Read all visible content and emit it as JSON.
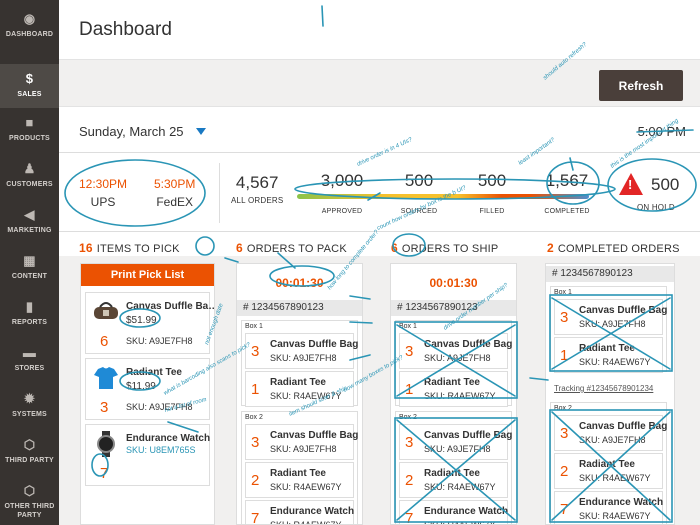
{
  "nav": [
    {
      "label": "DASHBOARD",
      "icon": "dashboard-icon",
      "glyph": "◉"
    },
    {
      "label": "SALES",
      "icon": "dollar-icon",
      "glyph": "$"
    },
    {
      "label": "PRODUCTS",
      "icon": "box-icon",
      "glyph": "■"
    },
    {
      "label": "CUSTOMERS",
      "icon": "person-icon",
      "glyph": "♟"
    },
    {
      "label": "MARKETING",
      "icon": "megaphone-icon",
      "glyph": "◀"
    },
    {
      "label": "CONTENT",
      "icon": "content-icon",
      "glyph": "▦"
    },
    {
      "label": "REPORTS",
      "icon": "bar-chart-icon",
      "glyph": "▮"
    },
    {
      "label": "STORES",
      "icon": "store-icon",
      "glyph": "▬"
    },
    {
      "label": "SYSTEMS",
      "icon": "gear-icon",
      "glyph": "✹"
    },
    {
      "label": "THIRD PARTY",
      "icon": "hexagon-icon",
      "glyph": "⬡"
    },
    {
      "label": "OTHER THIRD PARTY",
      "icon": "hexagon-icon",
      "glyph": "⬡"
    }
  ],
  "header": {
    "title": "Dashboard"
  },
  "toolbar": {
    "refresh_label": "Refresh"
  },
  "date": {
    "label": "Sunday, March 25",
    "time": "5:00 PM"
  },
  "carriers": [
    {
      "time": "12:30PM",
      "name": "UPS"
    },
    {
      "time": "5:30PM",
      "name": "FedEX"
    }
  ],
  "metrics": {
    "all_orders": {
      "value": "4,567",
      "label": "ALL ORDERS"
    },
    "stats": [
      {
        "value": "3,000",
        "label": "APPROVED"
      },
      {
        "value": "500",
        "label": "SOURCED"
      },
      {
        "value": "500",
        "label": "FILLED"
      },
      {
        "value": "1,567",
        "label": "COMPLETED"
      }
    ],
    "on_hold": {
      "value": "500",
      "label": "ON HOLD",
      "icon_glyph": "!"
    }
  },
  "columns": {
    "pick": {
      "count": "16",
      "label": "ITEMS TO PICK",
      "button": "Print Pick List"
    },
    "pack": {
      "count": "6",
      "label": "ORDERS TO PACK",
      "timer": "00:01:30",
      "order": "# 1234567890123"
    },
    "ship": {
      "count": "6",
      "label": "ORDERS TO SHIP",
      "timer": "00:01:30",
      "order": "# 1234567890123"
    },
    "completed": {
      "count": "2",
      "label": "COMPLETED ORDERS",
      "order": "# 1234567890123",
      "tracking": "Tracking #12345678901234"
    }
  },
  "pick_items": [
    {
      "name": "Canvas Duffle Ba…",
      "price": "$51.99",
      "qty": "6",
      "sku": "SKU: A9JE7FH8"
    },
    {
      "name": "Radiant Tee",
      "price": "$11.99",
      "qty": "3",
      "sku": "SKU: A9JE7FH8"
    },
    {
      "name": "Endurance Watch",
      "price": "",
      "qty": "7",
      "sku": "SKU: U8EM765S"
    }
  ],
  "box_labels": {
    "box1": "Box 1",
    "box2": "Box 2"
  },
  "lines": {
    "duffle": {
      "qty": "3",
      "name": "Canvas Duffle Bag",
      "sku": "SKU: A9JE7FH8"
    },
    "tee": {
      "qty": "1",
      "name": "Radiant Tee",
      "sku": "SKU: R4AEW67Y"
    },
    "tee2": {
      "qty": "2",
      "name": "Radiant Tee",
      "sku": "SKU: R4AEW67Y"
    },
    "watch": {
      "qty": "7",
      "name": "Endurance Watch",
      "sku": "SKU: R4AEW67Y"
    }
  },
  "annotations": [
    "should auto refresh?",
    "drive order is in 4 UIs?",
    "least important?",
    "this is the most important thing",
    "how long to complete order?",
    "count how orders by box is the b UI?",
    "drive order number per ship?",
    "not enough date",
    "what is barcoding also scans to pick?",
    "not a lot of room",
    "item should scan & ship",
    "how many boxes to pick?"
  ],
  "colors": {
    "accent": "#eb5202",
    "sidebar": "#373330",
    "refresh": "#4a3f3a",
    "annotation": "#2a95b5"
  }
}
